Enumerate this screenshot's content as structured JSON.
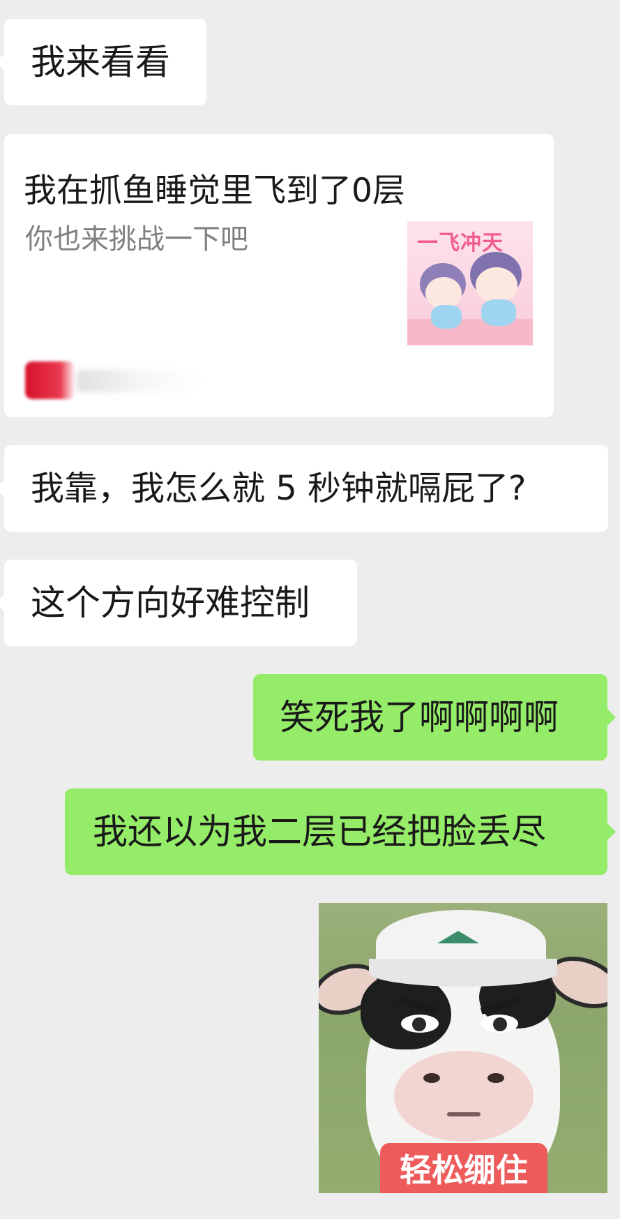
{
  "messages": [
    {
      "side": "left",
      "text": "我来看看"
    },
    {
      "side": "left",
      "type": "share_card",
      "title": "我在抓鱼睡觉里飞到了0层",
      "subtitle": "你也来挑战一下吧",
      "thumbnail_text": "一飞冲天"
    },
    {
      "side": "left",
      "text": "我靠，我怎么就 5 秒钟就嗝屁了?"
    },
    {
      "side": "left",
      "text": "这个方向好难控制"
    },
    {
      "side": "right",
      "text": "笑死我了啊啊啊啊"
    },
    {
      "side": "right",
      "text": "我还以为我二层已经把脸丢尽"
    },
    {
      "side": "right",
      "type": "sticker",
      "icon": "cow-meme-sticker",
      "caption": "轻松绷住"
    }
  ],
  "colors": {
    "background": "#ededed",
    "incoming_bubble": "#ffffff",
    "outgoing_bubble": "#95ec69",
    "text": "#191919",
    "subtext": "#808080",
    "sticker_caption_bg": "#ee5b5b"
  }
}
